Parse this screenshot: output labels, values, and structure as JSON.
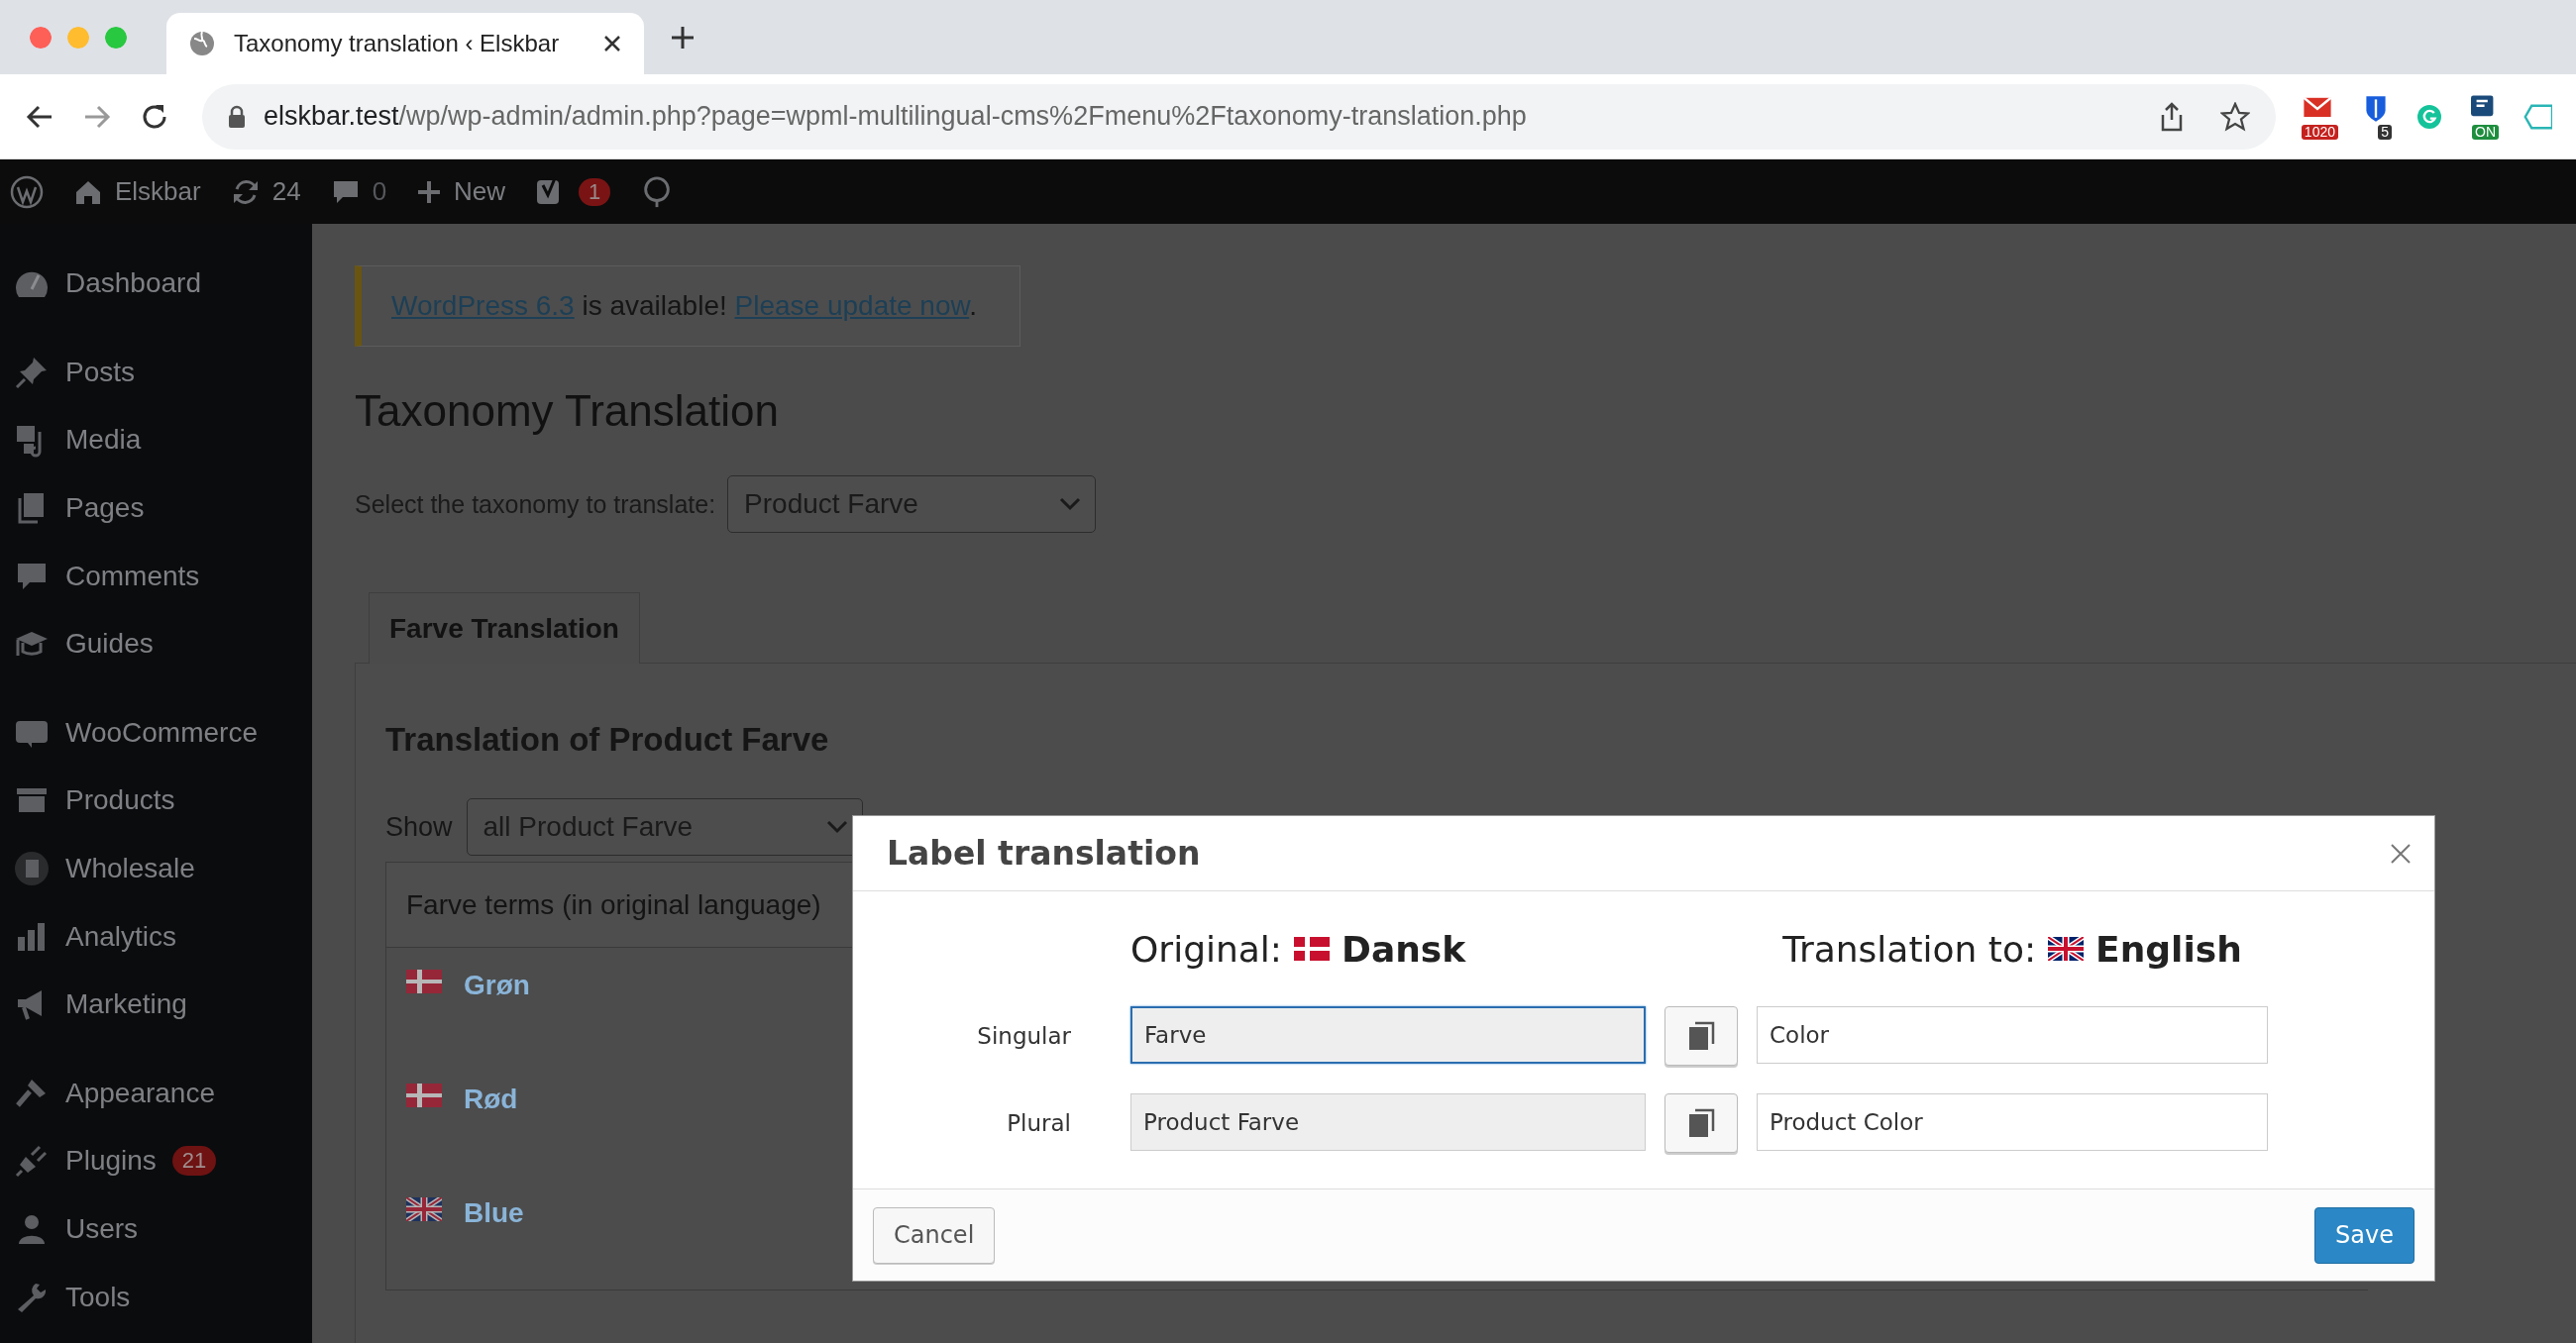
{
  "browser": {
    "tab_title": "Taxonomy translation ‹ Elskbar",
    "url_host": "elskbar.test",
    "url_path": "/wp/wp-admin/admin.php?page=wpml-multilingual-cms%2Fmenu%2Ftaxonomy-translation.php",
    "extensions": [
      {
        "kind": "mail",
        "badge": "1020"
      },
      {
        "kind": "shield",
        "badge": "5"
      },
      {
        "kind": "grammar"
      },
      {
        "kind": "toggle",
        "badge": "ON"
      },
      {
        "kind": "partial"
      }
    ]
  },
  "admin_bar": {
    "site": "Elskbar",
    "updates": "24",
    "comments": "0",
    "new": "New",
    "seo_badge": "1"
  },
  "sidebar": {
    "groups": [
      [
        {
          "label": "Dashboard"
        }
      ],
      [
        {
          "label": "Posts"
        },
        {
          "label": "Media"
        },
        {
          "label": "Pages"
        },
        {
          "label": "Comments"
        },
        {
          "label": "Guides"
        }
      ],
      [
        {
          "label": "WooCommerce"
        },
        {
          "label": "Products"
        },
        {
          "label": "Wholesale"
        },
        {
          "label": "Analytics"
        },
        {
          "label": "Marketing"
        }
      ],
      [
        {
          "label": "Appearance"
        },
        {
          "label": "Plugins",
          "badge": "21"
        },
        {
          "label": "Users"
        },
        {
          "label": "Tools"
        }
      ]
    ]
  },
  "notice": {
    "version_link": "WordPress 6.3",
    "text": "is available!",
    "update_link": "Please update now",
    "end": "."
  },
  "page_title": "Taxonomy Translation",
  "taxonomy_select": {
    "label": "Select the taxonomy to translate:",
    "value": "Product Farve"
  },
  "tabs": [
    {
      "label": "Farve Translation",
      "selected": true
    }
  ],
  "section_title": "Translation of Product Farve",
  "filter": {
    "label": "Show",
    "value": "all Product Farve"
  },
  "table": {
    "columns": [
      "Farve terms (in original language)"
    ],
    "rows": [
      {
        "kind": "dk",
        "term": "Grøn"
      },
      {
        "kind": "dk",
        "term": "Rød"
      },
      {
        "kind": "gb",
        "term": "Blue"
      }
    ]
  },
  "dialog": {
    "title": "Label translation",
    "original": {
      "label": "Original:",
      "kind": "dk",
      "language": "Dansk"
    },
    "translation": {
      "label": "Translation to:",
      "kind": "gb",
      "language": "English"
    },
    "rows": [
      {
        "label": "Singular",
        "original": "Farve",
        "translation": "Color",
        "focused": true
      },
      {
        "label": "Plural",
        "original": "Product Farve",
        "translation": "Product Color",
        "focused": false
      }
    ],
    "cancel": "Cancel",
    "save": "Save"
  }
}
